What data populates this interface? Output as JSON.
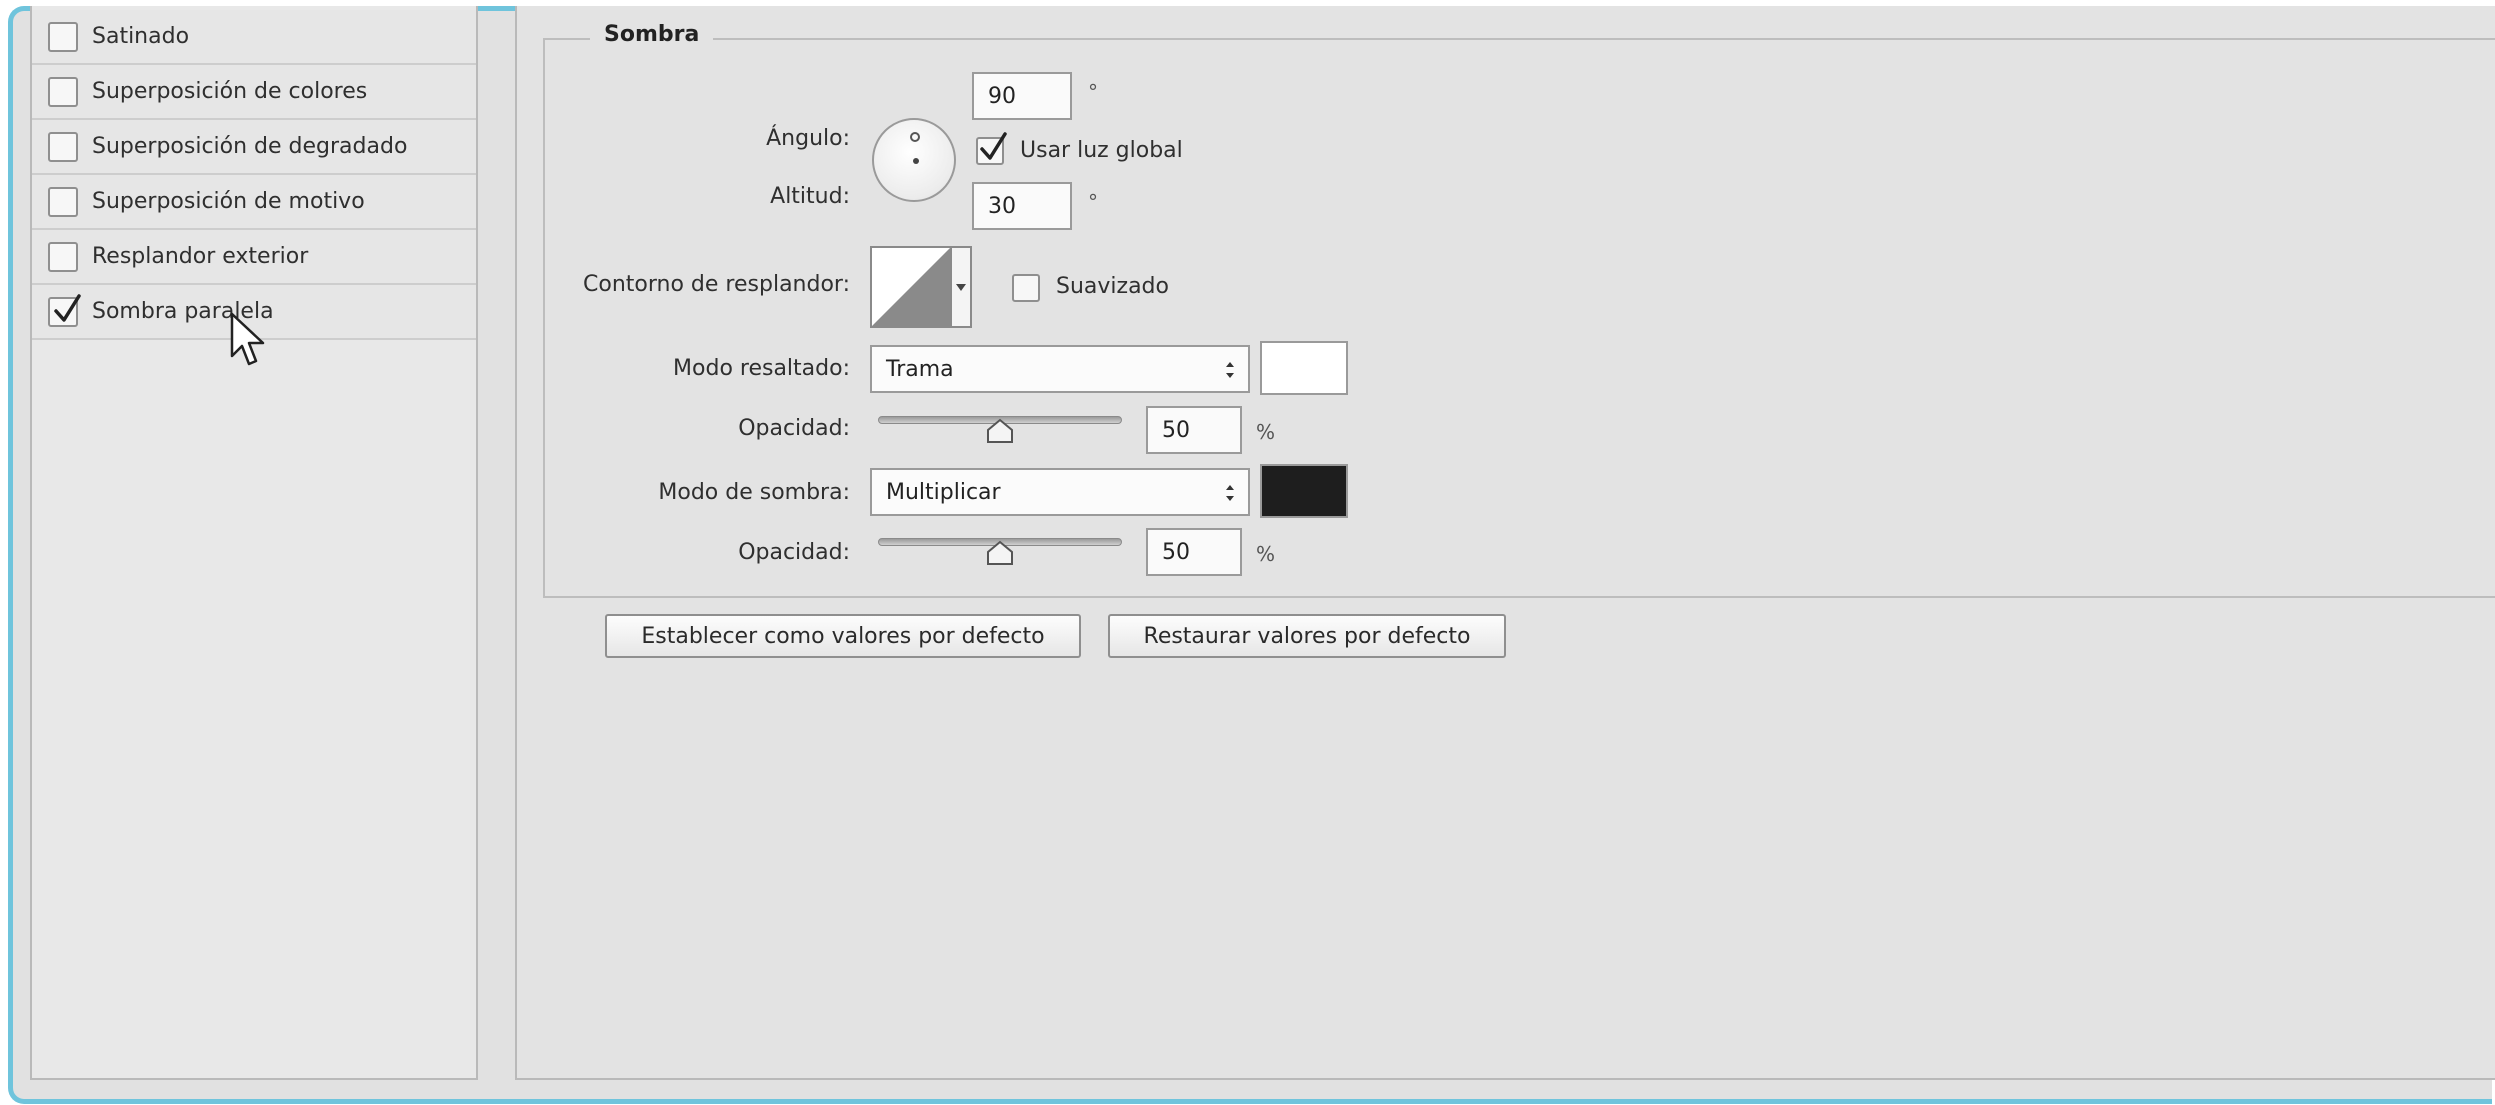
{
  "style_list": {
    "items": [
      {
        "label": "Satinado",
        "checked": false
      },
      {
        "label": "Superposición de colores",
        "checked": false
      },
      {
        "label": "Superposición de degradado",
        "checked": false
      },
      {
        "label": "Superposición de motivo",
        "checked": false
      },
      {
        "label": "Resplandor exterior",
        "checked": false
      },
      {
        "label": "Sombra paralela",
        "checked": true
      }
    ]
  },
  "sombra": {
    "title": "Sombra",
    "angulo_label": "Ángulo:",
    "angulo_value": "90",
    "degree_symbol": "°",
    "usar_luz_global_label": "Usar luz global",
    "usar_luz_global_checked": true,
    "altitud_label": "Altitud:",
    "altitud_value": "30",
    "contorno_label": "Contorno de resplandor:",
    "suavizado_label": "Suavizado",
    "suavizado_checked": false,
    "modo_resaltado_label": "Modo resaltado:",
    "modo_resaltado_value": "Trama",
    "highlight_color": "#ffffff",
    "opacidad_label": "Opacidad:",
    "highlight_opacity": "50",
    "percent_symbol": "%",
    "modo_sombra_label": "Modo de sombra:",
    "modo_sombra_value": "Multiplicar",
    "shadow_color": "#1e1e1e",
    "shadow_opacity": "50"
  },
  "buttons": {
    "set_default": "Establecer como valores por defecto",
    "reset_default": "Restaurar valores por defecto"
  }
}
